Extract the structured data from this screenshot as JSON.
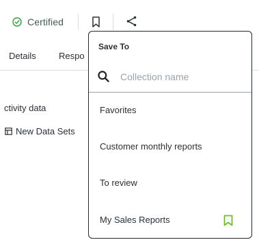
{
  "header": {
    "certified_label": "Certified",
    "certified_color": "#2e9e3f",
    "bookmark_icon": "bookmark-icon",
    "share_icon": "share-icon"
  },
  "tabs": [
    {
      "label": "Details"
    },
    {
      "label": "Respo"
    }
  ],
  "content": {
    "activity_label": "ctivity data",
    "datasets_label": "New Data Sets"
  },
  "popover": {
    "title": "Save To",
    "search": {
      "placeholder": "Collection name",
      "value": ""
    },
    "items": [
      {
        "label": "Favorites",
        "saved": false
      },
      {
        "label": "Customer monthly reports",
        "saved": false
      },
      {
        "label": "To review",
        "saved": false
      },
      {
        "label": "My Sales Reports",
        "saved": true
      }
    ],
    "saved_color": "#6dbf1f"
  }
}
